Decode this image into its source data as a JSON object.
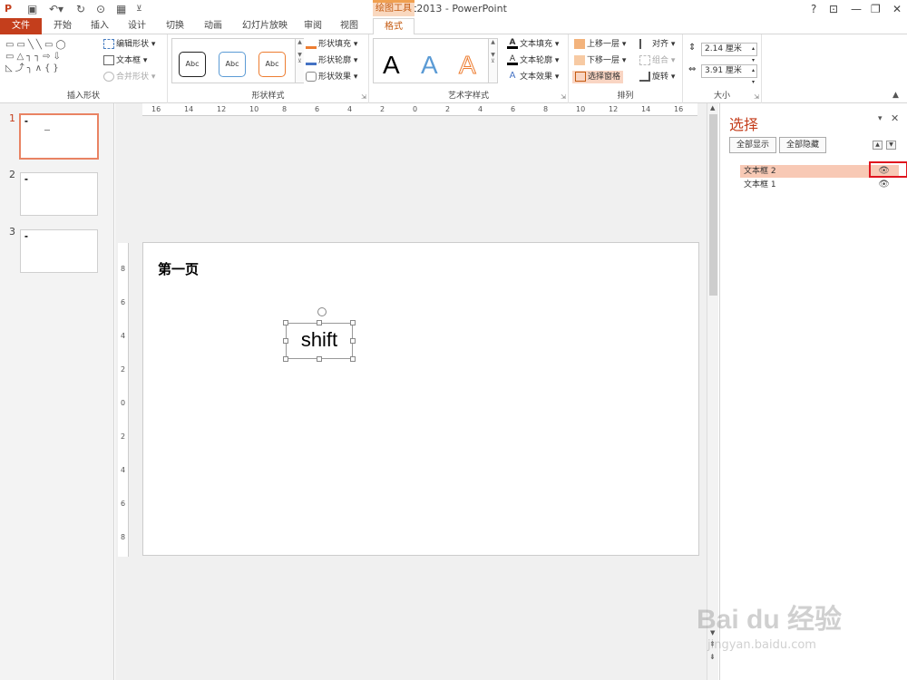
{
  "titlebar": {
    "app_title": "ppt2013 - PowerPoint",
    "context_tools": "绘图工具",
    "help": "?",
    "minimize": "—",
    "restore": "❐",
    "close": "✕",
    "ribbon_display": "⊡"
  },
  "tabs": [
    "文件",
    "开始",
    "插入",
    "设计",
    "切换",
    "动画",
    "幻灯片放映",
    "审阅",
    "视图",
    "格式"
  ],
  "ribbon": {
    "insert_shapes": {
      "edit_shape": "编辑形状",
      "textbox": "文本框",
      "merge_shapes": "合并形状",
      "label": "插入形状"
    },
    "shape_styles": {
      "samples": [
        "Abc",
        "Abc",
        "Abc"
      ],
      "fill": "形状填充",
      "outline": "形状轮廓",
      "effects": "形状效果",
      "label": "形状样式"
    },
    "wordart": {
      "samples": [
        "A",
        "A",
        "A"
      ],
      "text_fill": "文本填充",
      "text_outline": "文本轮廓",
      "text_effects": "文本效果",
      "label": "艺术字样式"
    },
    "arrange": {
      "bring_forward": "上移一层",
      "send_backward": "下移一层",
      "selection_pane": "选择窗格",
      "align": "对齐",
      "group": "组合",
      "rotate": "旋转",
      "label": "排列"
    },
    "size": {
      "height": "2.14 厘米",
      "width": "3.91 厘米",
      "label": "大小"
    }
  },
  "thumbnails": [
    {
      "num": "1",
      "selected": true
    },
    {
      "num": "2",
      "selected": false
    },
    {
      "num": "3",
      "selected": false
    }
  ],
  "ruler": {
    "h": [
      "16",
      "14",
      "12",
      "10",
      "8",
      "6",
      "4",
      "2",
      "0",
      "2",
      "4",
      "6",
      "8",
      "10",
      "12",
      "14",
      "16"
    ],
    "v": [
      "8",
      "6",
      "4",
      "2",
      "0",
      "2",
      "4",
      "6",
      "8"
    ]
  },
  "slide": {
    "title": "第一页",
    "textbox_text": "shift"
  },
  "pane": {
    "title": "选择",
    "show_all": "全部显示",
    "hide_all": "全部隐藏",
    "items": [
      {
        "label": "文本框 2",
        "selected": true
      },
      {
        "label": "文本框 1",
        "selected": false
      }
    ]
  },
  "watermark": {
    "brand": "Bai du 经验",
    "url": "jingyan.baidu.com"
  }
}
